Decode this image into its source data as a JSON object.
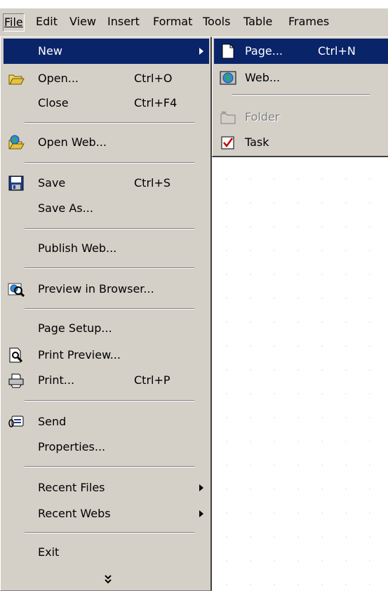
{
  "menubar": {
    "items": [
      {
        "label": "File"
      },
      {
        "label": "Edit"
      },
      {
        "label": "View"
      },
      {
        "label": "Insert"
      },
      {
        "label": "Format"
      },
      {
        "label": "Tools"
      },
      {
        "label": "Table"
      },
      {
        "label": "Frames"
      }
    ]
  },
  "file_menu": {
    "items": [
      {
        "label": "New",
        "icon": "none",
        "has_submenu": true,
        "highlighted": true
      },
      {
        "label": "Open...",
        "shortcut": "Ctrl+O",
        "icon": "open-folder-icon"
      },
      {
        "label": "Close",
        "shortcut": "Ctrl+F4"
      },
      {
        "label": "Open Web...",
        "icon": "open-web-icon"
      },
      {
        "label": "Save",
        "shortcut": "Ctrl+S",
        "icon": "floppy-disk-icon"
      },
      {
        "label": "Save As..."
      },
      {
        "label": "Publish Web..."
      },
      {
        "label": "Preview in Browser...",
        "icon": "preview-browser-icon"
      },
      {
        "label": "Page Setup..."
      },
      {
        "label": "Print Preview...",
        "icon": "print-preview-icon"
      },
      {
        "label": "Print...",
        "shortcut": "Ctrl+P",
        "icon": "printer-icon"
      },
      {
        "label": "Send",
        "icon": "send-mail-icon"
      },
      {
        "label": "Properties..."
      },
      {
        "label": "Recent Files",
        "has_submenu": true
      },
      {
        "label": "Recent Webs",
        "has_submenu": true
      },
      {
        "label": "Exit"
      }
    ],
    "expand_icon": "double-chevron-down-icon"
  },
  "new_submenu": {
    "items": [
      {
        "label": "Page...",
        "shortcut": "Ctrl+N",
        "icon": "blank-page-icon",
        "highlighted": true
      },
      {
        "label": "Web...",
        "icon": "web-globe-icon"
      },
      {
        "label": "Folder",
        "icon": "folder-icon",
        "disabled": true
      },
      {
        "label": "Task",
        "icon": "task-checkbox-icon"
      }
    ]
  },
  "colors": {
    "menu_bg": "#d4d0c8",
    "highlight": "#0a246a",
    "highlight_text": "#ffffff",
    "disabled_text": "#808080"
  }
}
